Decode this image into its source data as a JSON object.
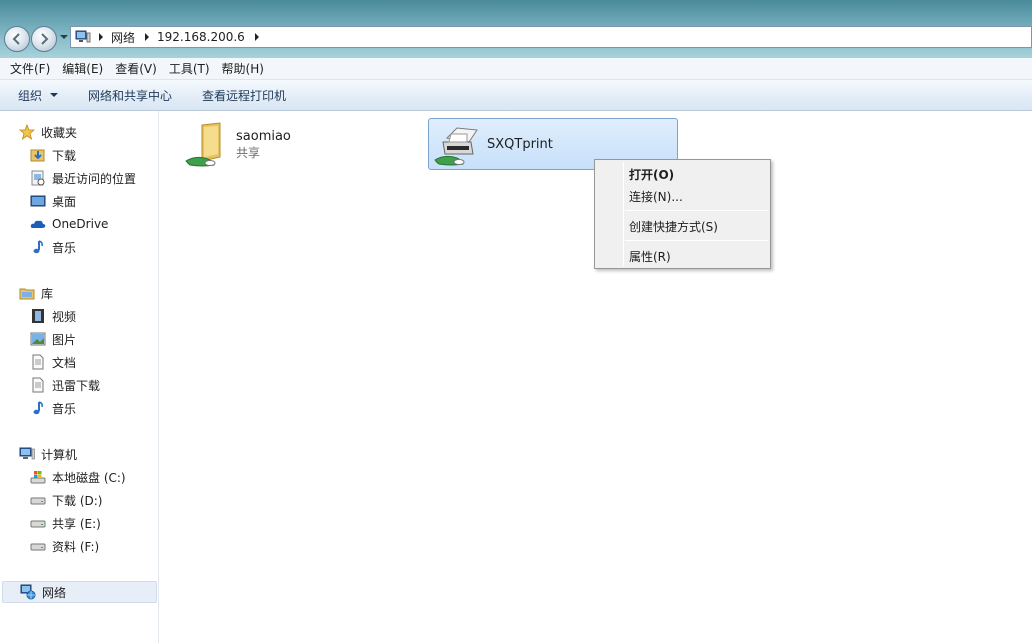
{
  "address_bar": {
    "crumbs": [
      "网络",
      "192.168.200.6"
    ]
  },
  "menu": [
    "文件(F)",
    "编辑(E)",
    "查看(V)",
    "工具(T)",
    "帮助(H)"
  ],
  "commands": {
    "organize": "组织",
    "network_center": "网络和共享中心",
    "remote_printers": "查看远程打印机"
  },
  "sidebar": {
    "favorites": {
      "label": "收藏夹",
      "items": [
        "下载",
        "最近访问的位置",
        "桌面",
        "OneDrive",
        "音乐"
      ]
    },
    "libraries": {
      "label": "库",
      "items": [
        "视频",
        "图片",
        "文档",
        "迅雷下载",
        "音乐"
      ]
    },
    "computer": {
      "label": "计算机",
      "items": [
        "本地磁盘 (C:)",
        "下载 (D:)",
        "共享 (E:)",
        "资料 (F:)"
      ]
    },
    "network": {
      "label": "网络"
    }
  },
  "content": {
    "folder": {
      "name": "saomiao",
      "subtitle": "共享"
    },
    "printer": {
      "name": "SXQTprint"
    }
  },
  "context_menu": {
    "open": "打开(O)",
    "connect": "连接(N)...",
    "shortcut": "创建快捷方式(S)",
    "properties": "属性(R)"
  },
  "colors": {
    "selection_bg": "#c7e0fa",
    "titlebar": "#6aa5b4"
  }
}
